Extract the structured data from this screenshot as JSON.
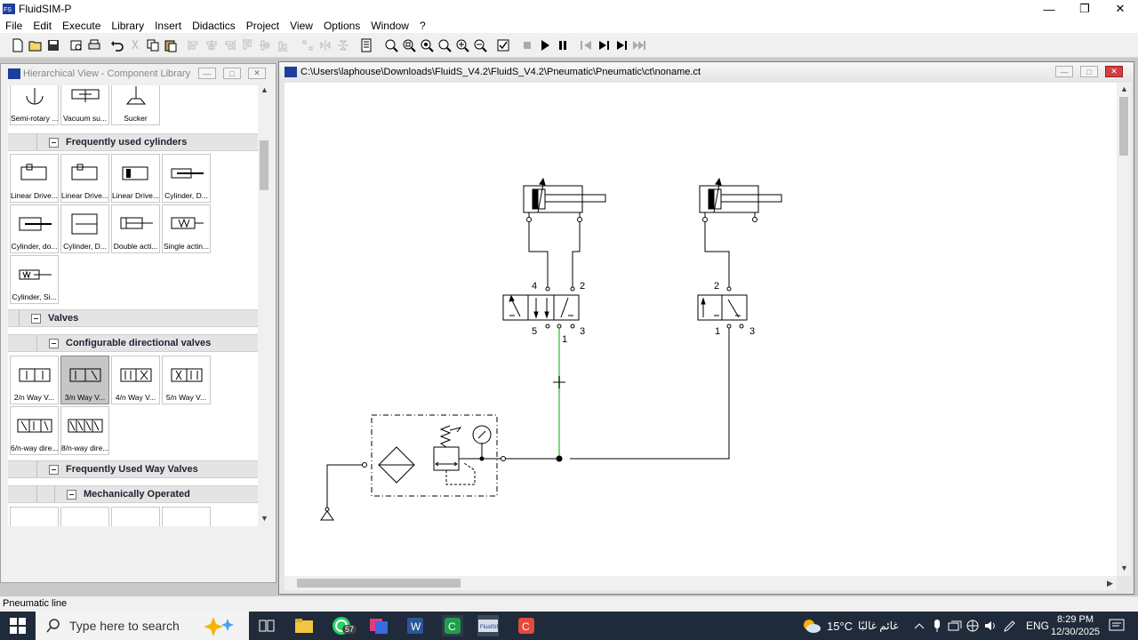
{
  "window": {
    "title": "FluidSIM-P"
  },
  "menu": [
    "File",
    "Edit",
    "Execute",
    "Library",
    "Insert",
    "Didactics",
    "Project",
    "View",
    "Options",
    "Window",
    "?"
  ],
  "library": {
    "title": "Hierarchical View - Component Library",
    "top_tiles": [
      "Semi-rotary ...",
      "Vacuum su...",
      "Sucker"
    ],
    "groups": {
      "cylinders": "Frequently used cylinders",
      "valves": "Valves",
      "config_valves": "Configurable directional valves",
      "way_valves": "Frequently Used Way Valves",
      "mech": "Mechanically Operated"
    },
    "cylinder_tiles": [
      "Linear Drive...",
      "Linear Drive...",
      "Linear Drive...",
      "Cylinder, D...",
      "Cylinder, do...",
      "Cylinder, D...",
      "Double acti...",
      "Single actin...",
      "Cylinder, Si..."
    ],
    "valve_tiles": [
      "2/n Way V...",
      "3/n Way V...",
      "4/n Way V...",
      "5/n Way V...",
      "6/n-way dire...",
      "8/n-way dire..."
    ],
    "selected_valve_tile": "3/n Way V..."
  },
  "drawing": {
    "title": "C:\\Users\\laphouse\\Downloads\\FluidS_V4.2\\FluidS_V4.2\\Pneumatic\\Pneumatic\\ct\\noname.ct",
    "port_labels": {
      "v1_4": "4",
      "v1_2": "2",
      "v1_5": "5",
      "v1_1": "1",
      "v1_3": "3",
      "v2_2": "2",
      "v2_1": "1",
      "v2_3": "3"
    },
    "highlight_color": "#7ed67e"
  },
  "status": {
    "text": "Pneumatic line"
  },
  "taskbar": {
    "search_placeholder": "Type here to search",
    "whatsapp_badge": "57",
    "weather": "15°C",
    "weather_desc": "غائم غالبًا",
    "language": "ENG",
    "time": "8:29 PM",
    "date": "12/30/2025"
  }
}
